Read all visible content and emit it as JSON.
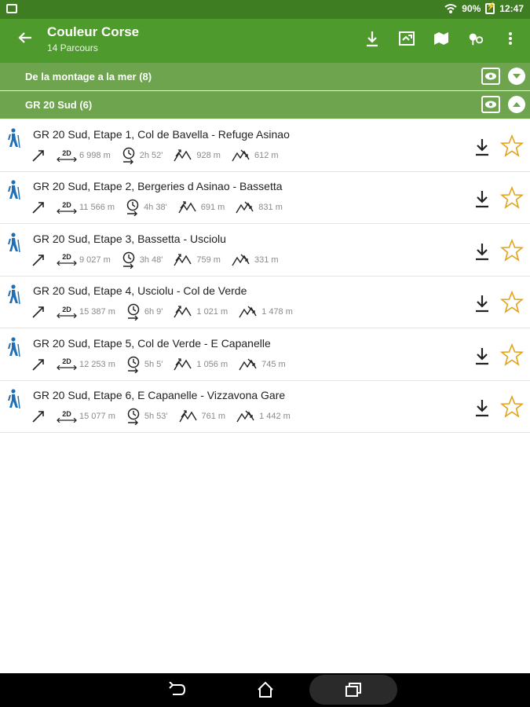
{
  "status": {
    "wifi": "wifi-icon",
    "battery_pct": "90%",
    "time": "12:47"
  },
  "app": {
    "title": "Couleur Corse",
    "subtitle": "14 Parcours"
  },
  "groups": [
    {
      "label": "De la montage a la mer (8)",
      "expanded": false
    },
    {
      "label": "GR 20 Sud (6)",
      "expanded": true
    }
  ],
  "items": [
    {
      "name": "GR 20 Sud, Etape 1, Col de Bavella - Refuge Asinao",
      "dist": "6 998 m",
      "time": "2h 52'",
      "up": "928 m",
      "down": "612 m"
    },
    {
      "name": "GR 20 Sud, Etape 2, Bergeries d Asinao - Bassetta",
      "dist": "11 566 m",
      "time": "4h 38'",
      "up": "691 m",
      "down": "831 m"
    },
    {
      "name": "GR 20 Sud, Etape 3, Bassetta - Usciolu",
      "dist": "9 027 m",
      "time": "3h 48'",
      "up": "759 m",
      "down": "331 m"
    },
    {
      "name": "GR 20 Sud, Etape 4, Usciolu - Col de Verde",
      "dist": "15 387 m",
      "time": "6h 9'",
      "up": "1 021 m",
      "down": "1 478 m"
    },
    {
      "name": "GR 20 Sud, Etape 5, Col de Verde - E Capanelle",
      "dist": "12 253 m",
      "time": "5h 5'",
      "up": "1 056 m",
      "down": "745 m"
    },
    {
      "name": "GR 20 Sud, Etape 6, E Capanelle - Vizzavona Gare",
      "dist": "15 077 m",
      "time": "5h 53'",
      "up": "761 m",
      "down": "1 442 m"
    }
  ],
  "labels": {
    "two_d": "2D"
  },
  "colors": {
    "appbar": "#4f9a2d",
    "group": "#6ea44e",
    "hiker": "#1e6fb5",
    "star": "#e3a21a"
  }
}
